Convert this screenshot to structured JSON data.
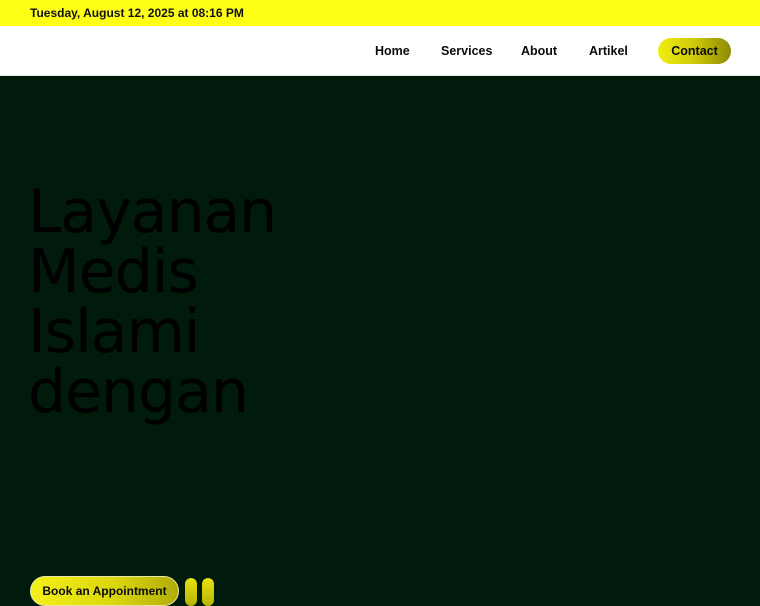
{
  "topbar": {
    "datetime": "Tuesday, August 12, 2025 at 08:16 PM",
    "background_color": "#ffff16"
  },
  "nav": {
    "items": [
      {
        "label": "Home"
      },
      {
        "label": "Services"
      },
      {
        "label": "About"
      },
      {
        "label": "Artikel"
      }
    ],
    "contact_label": "Contact"
  },
  "hero": {
    "title_lines": [
      "Layanan",
      "Medis",
      "Islami",
      "dengan"
    ],
    "cta_label": "Book an Appointment",
    "background_color": "#001a0c",
    "accent_color": "#f2ee10"
  }
}
